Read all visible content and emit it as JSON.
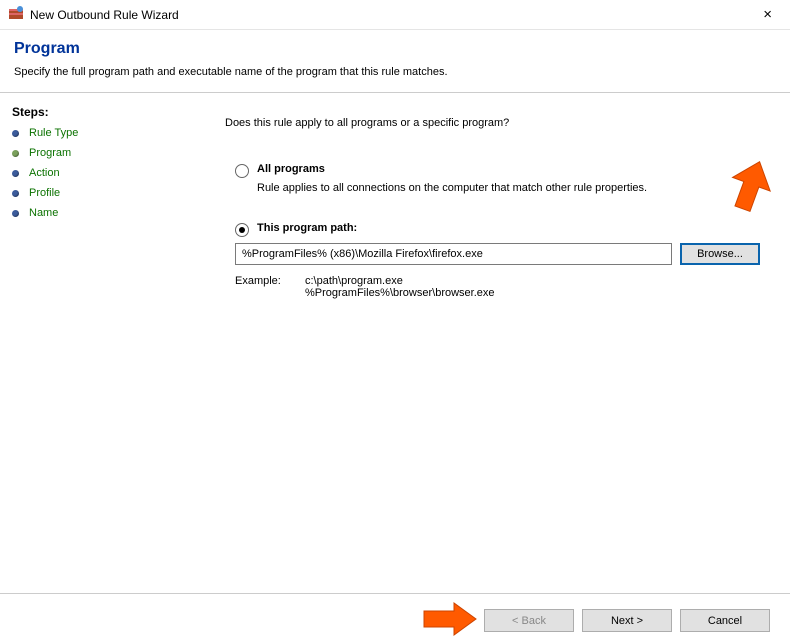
{
  "window": {
    "title": "New Outbound Rule Wizard",
    "close": "×"
  },
  "header": {
    "title": "Program",
    "subtitle": "Specify the full program path and executable name of the program that this rule matches."
  },
  "sidebar": {
    "title": "Steps:",
    "steps": [
      "Rule Type",
      "Program",
      "Action",
      "Profile",
      "Name"
    ]
  },
  "main": {
    "question": "Does this rule apply to all programs or a specific program?",
    "allPrograms": {
      "label": "All programs",
      "sub": "Rule applies to all connections on the computer that match other rule properties."
    },
    "thisPath": {
      "label": "This program path:",
      "value": "%ProgramFiles% (x86)\\Mozilla Firefox\\firefox.exe",
      "browse": "Browse..."
    },
    "example": {
      "label": "Example:",
      "line1": "c:\\path\\program.exe",
      "line2": "%ProgramFiles%\\browser\\browser.exe"
    }
  },
  "footer": {
    "back": "< Back",
    "next": "Next >",
    "cancel": "Cancel"
  }
}
